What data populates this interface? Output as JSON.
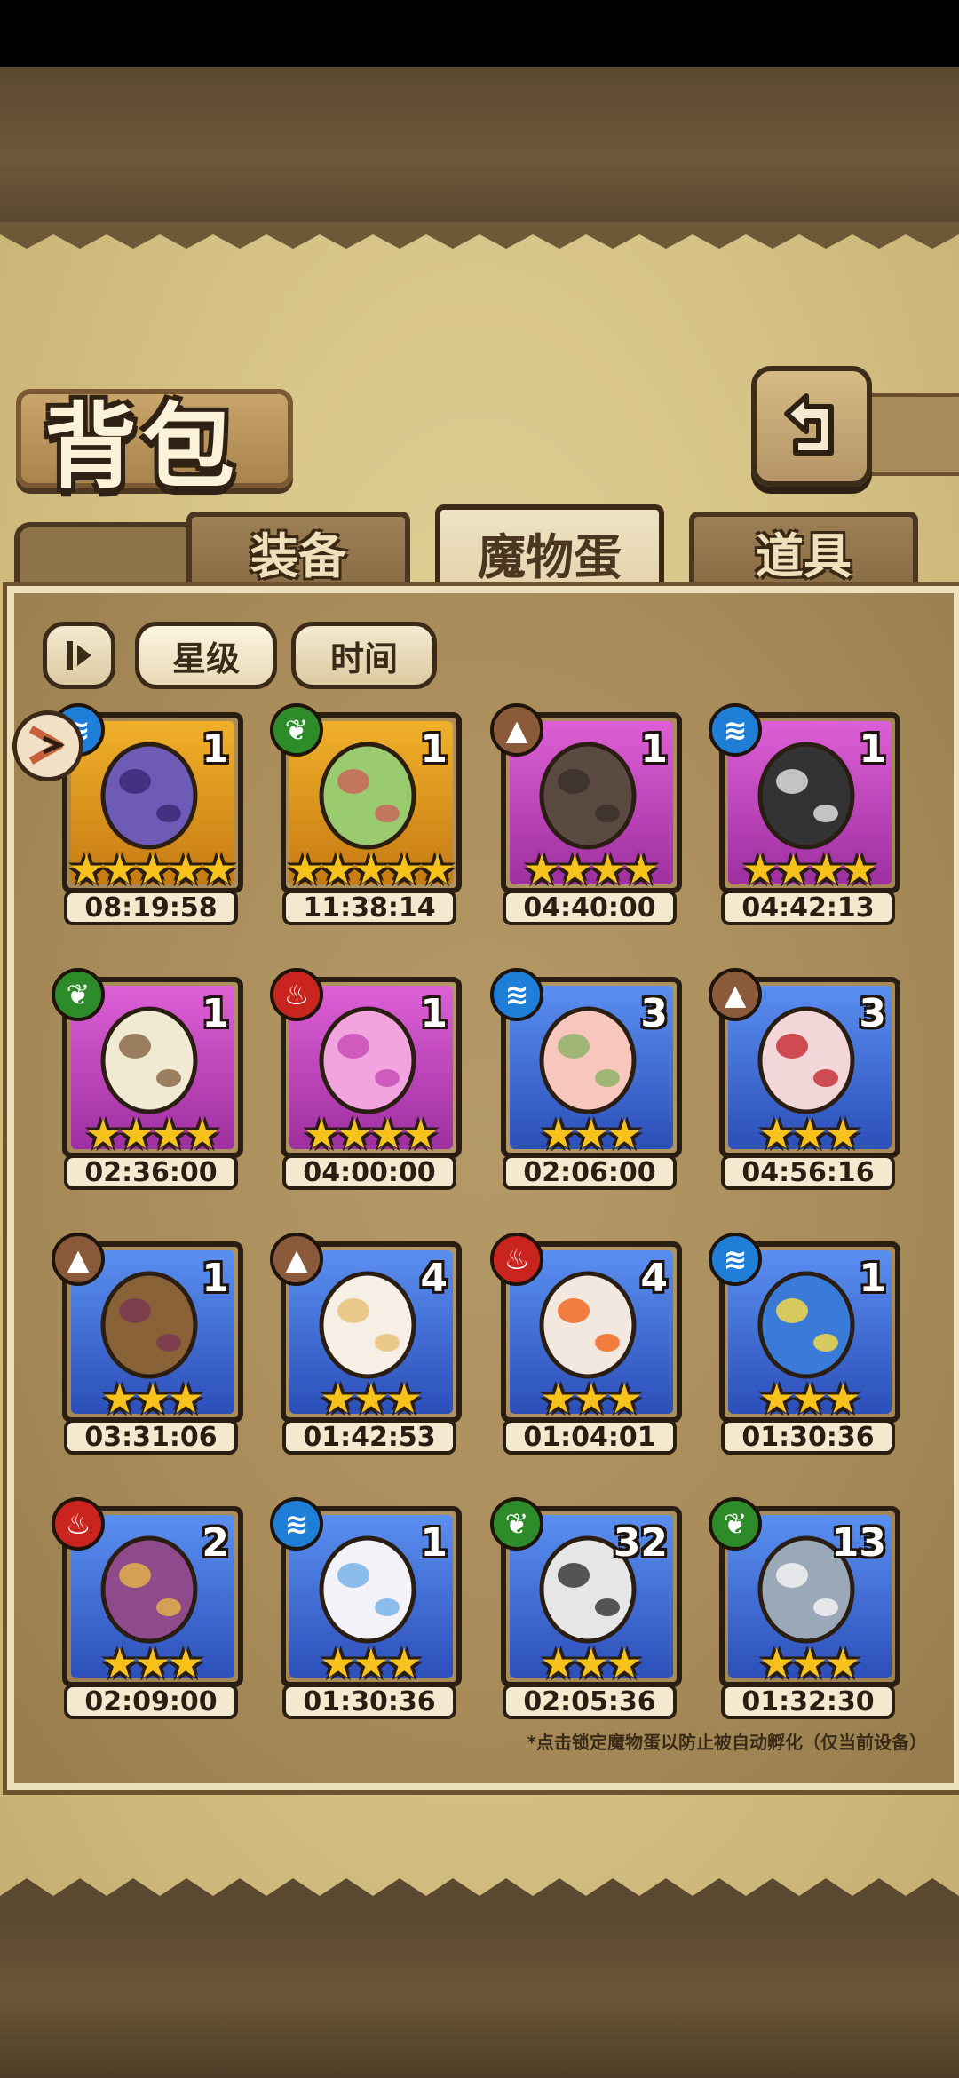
{
  "title": "背包",
  "tabs": [
    {
      "label": "装备",
      "active": false
    },
    {
      "label": "魔物蛋",
      "active": true
    },
    {
      "label": "道具",
      "active": false
    }
  ],
  "sort": {
    "icon_name": "sort-toggle-icon",
    "star_label": "星级",
    "time_label": "时间"
  },
  "back_icon": "back-arrow-icon",
  "eggs": [
    {
      "rarity": "orange",
      "element": "water",
      "stars": 5,
      "count": "1",
      "timer": "08:19:58"
    },
    {
      "rarity": "orange",
      "element": "nature",
      "stars": 5,
      "count": "1",
      "timer": "11:38:14"
    },
    {
      "rarity": "purple",
      "element": "earth",
      "stars": 4,
      "count": "1",
      "timer": "04:40:00"
    },
    {
      "rarity": "purple",
      "element": "water",
      "stars": 4,
      "count": "1",
      "timer": "04:42:13"
    },
    {
      "rarity": "purple",
      "element": "nature",
      "stars": 4,
      "count": "1",
      "timer": "02:36:00"
    },
    {
      "rarity": "purple",
      "element": "fire",
      "stars": 4,
      "count": "1",
      "timer": "04:00:00"
    },
    {
      "rarity": "blue",
      "element": "water",
      "stars": 3,
      "count": "3",
      "timer": "02:06:00"
    },
    {
      "rarity": "blue",
      "element": "earth",
      "stars": 3,
      "count": "3",
      "timer": "04:56:16"
    },
    {
      "rarity": "blue",
      "element": "earth",
      "stars": 3,
      "count": "1",
      "timer": "03:31:06"
    },
    {
      "rarity": "blue",
      "element": "earth",
      "stars": 3,
      "count": "4",
      "timer": "01:42:53"
    },
    {
      "rarity": "blue",
      "element": "fire",
      "stars": 3,
      "count": "4",
      "timer": "01:04:01"
    },
    {
      "rarity": "blue",
      "element": "water",
      "stars": 3,
      "count": "1",
      "timer": "01:30:36"
    },
    {
      "rarity": "blue",
      "element": "fire",
      "stars": 3,
      "count": "2",
      "timer": "02:09:00"
    },
    {
      "rarity": "blue",
      "element": "water",
      "stars": 3,
      "count": "1",
      "timer": "01:30:36"
    },
    {
      "rarity": "blue",
      "element": "nature",
      "stars": 3,
      "count": "32",
      "timer": "02:05:36"
    },
    {
      "rarity": "blue",
      "element": "nature",
      "stars": 3,
      "count": "13",
      "timer": "01:32:30"
    }
  ],
  "footnote": "*点击锁定魔物蛋以防止被自动孵化（仅当前设备）",
  "colors": {
    "accent": "#f6c21b",
    "paper": "#d6c285",
    "frame": "#3b2a17"
  }
}
